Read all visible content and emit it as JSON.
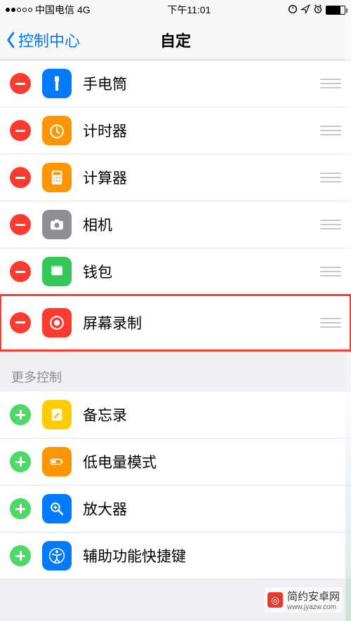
{
  "statusbar": {
    "carrier": "中国电信",
    "network": "4G",
    "time": "下午11:01"
  },
  "navbar": {
    "back_label": "控制中心",
    "title": "自定"
  },
  "included_items": [
    {
      "label": "手电筒",
      "icon": "flashlight",
      "icon_bg": "#007aff"
    },
    {
      "label": "计时器",
      "icon": "timer",
      "icon_bg": "#ff9500"
    },
    {
      "label": "计算器",
      "icon": "calculator",
      "icon_bg": "#ff9500"
    },
    {
      "label": "相机",
      "icon": "camera",
      "icon_bg": "#8e8e93"
    },
    {
      "label": "钱包",
      "icon": "wallet",
      "icon_bg": "#34c759"
    },
    {
      "label": "屏幕录制",
      "icon": "record",
      "icon_bg": "#ff3b30",
      "highlight": true
    }
  ],
  "section_more": "更多控制",
  "more_items": [
    {
      "label": "备忘录",
      "icon": "notes",
      "icon_bg": "#ffcc00"
    },
    {
      "label": "低电量模式",
      "icon": "lowpower",
      "icon_bg": "#ff9500"
    },
    {
      "label": "放大器",
      "icon": "magnifier",
      "icon_bg": "#007aff"
    },
    {
      "label": "辅助功能快捷键",
      "icon": "accessibility",
      "icon_bg": "#007aff"
    }
  ],
  "watermark": {
    "text": "简约安卓网",
    "url": "www.jyazw.com"
  }
}
